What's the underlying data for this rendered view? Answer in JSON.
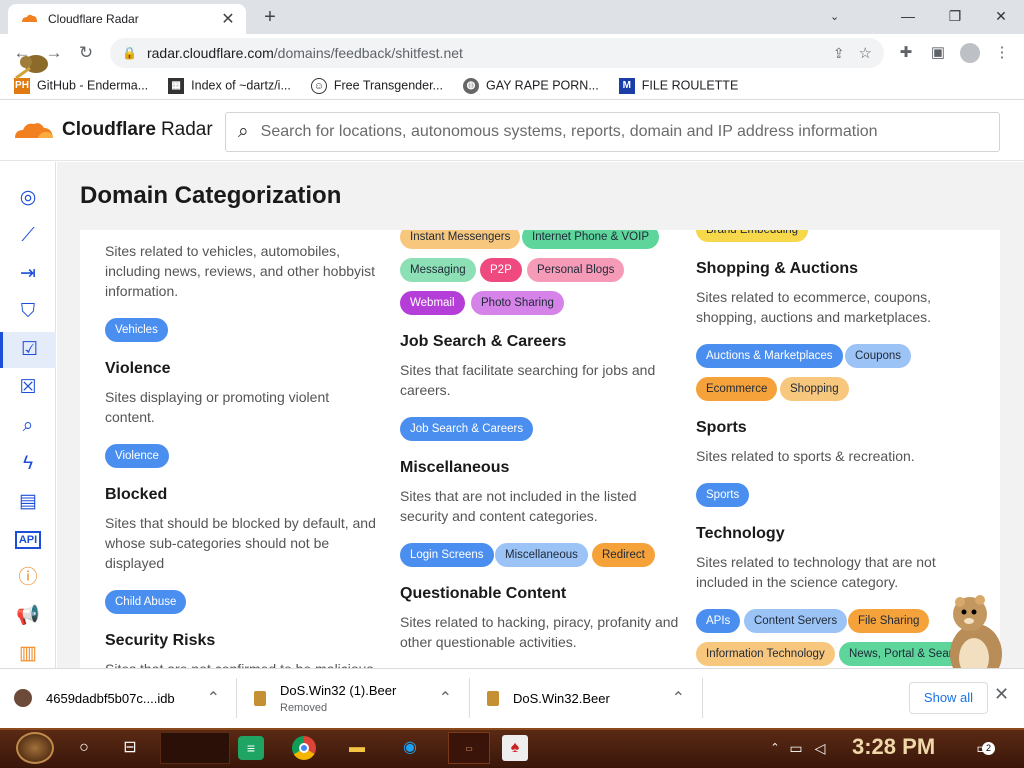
{
  "browser": {
    "tab_title": "Cloudflare Radar",
    "url_host": "radar.cloudflare.com",
    "url_path": "/domains/feedback/shitfest.net",
    "bookmarks": [
      {
        "label": "GitHub - Enderma...",
        "icon": "ph-favicon"
      },
      {
        "label": "Index of ~dartz/i...",
        "icon": "folder-favicon"
      },
      {
        "label": "Free Transgender...",
        "icon": "mask-favicon"
      },
      {
        "label": "GAY RAPE PORN...",
        "icon": "globe-favicon"
      },
      {
        "label": "FILE ROULETTE",
        "icon": "mft-favicon"
      }
    ]
  },
  "site": {
    "logo_brand": "Cloudflare",
    "logo_product": "Radar",
    "search_placeholder": "Search for locations, autonomous systems, reports, domain and IP address information",
    "page_title": "Domain Categorization"
  },
  "sidebar_icons": [
    "globe-icon",
    "trend-icon",
    "login-icon",
    "shield-icon",
    "calendar-check-icon",
    "calendar-x-icon",
    "search-icon",
    "bolt-icon",
    "document-check-icon",
    "api-icon",
    "help-icon",
    "megaphone-icon",
    "book-icon"
  ],
  "col1": {
    "vehicles_desc": "Sites related to vehicles, automobiles, including news, reviews, and other hobbyist information.",
    "vehicles_pill": "Vehicles",
    "violence_title": "Violence",
    "violence_desc": "Sites displaying or promoting violent content.",
    "violence_pill": "Violence",
    "blocked_title": "Blocked",
    "blocked_desc": "Sites that should be blocked by default, and whose sub-categories should not be displayed",
    "blocked_pill": "Child Abuse",
    "security_title": "Security Risks",
    "security_desc": "Sites that are not confirmed to be malicious"
  },
  "col2": {
    "top_pills": [
      "Instant Messengers",
      "Internet Phone & VOIP",
      "Messaging",
      "P2P",
      "Personal Blogs",
      "Webmail",
      "Photo Sharing"
    ],
    "job_title": "Job Search & Careers",
    "job_desc": "Sites that facilitate searching for jobs and careers.",
    "job_pill": "Job Search & Careers",
    "misc_title": "Miscellaneous",
    "misc_desc": "Sites that are not included in the listed security and content categories.",
    "misc_pills": [
      "Login Screens",
      "Miscellaneous",
      "Redirect"
    ],
    "qc_title": "Questionable Content",
    "qc_desc": "Sites related to hacking, piracy, profanity and other questionable activities."
  },
  "col3": {
    "top_pill": "Brand Embedding",
    "shop_title": "Shopping & Auctions",
    "shop_desc": "Sites related to ecommerce, coupons, shopping, auctions and marketplaces.",
    "shop_pills": [
      "Auctions & Marketplaces",
      "Coupons",
      "Ecommerce",
      "Shopping"
    ],
    "sports_title": "Sports",
    "sports_desc": "Sites related to sports & recreation.",
    "sports_pill": "Sports",
    "tech_title": "Technology",
    "tech_desc": "Sites related to technology that are not included in the science category.",
    "tech_pills": [
      "APIs",
      "Content Servers",
      "File Sharing",
      "Information Technology",
      "News, Portal & Search"
    ]
  },
  "downloads": [
    {
      "name": "4659dadbf5b07c....idb",
      "status": ""
    },
    {
      "name": "DoS.Win32 (1).Beer",
      "status": "Removed"
    },
    {
      "name": "DoS.Win32.Beer",
      "status": ""
    }
  ],
  "downloads_show_all": "Show all",
  "taskbar": {
    "clock": "3:28 PM",
    "notification_count": "2"
  }
}
